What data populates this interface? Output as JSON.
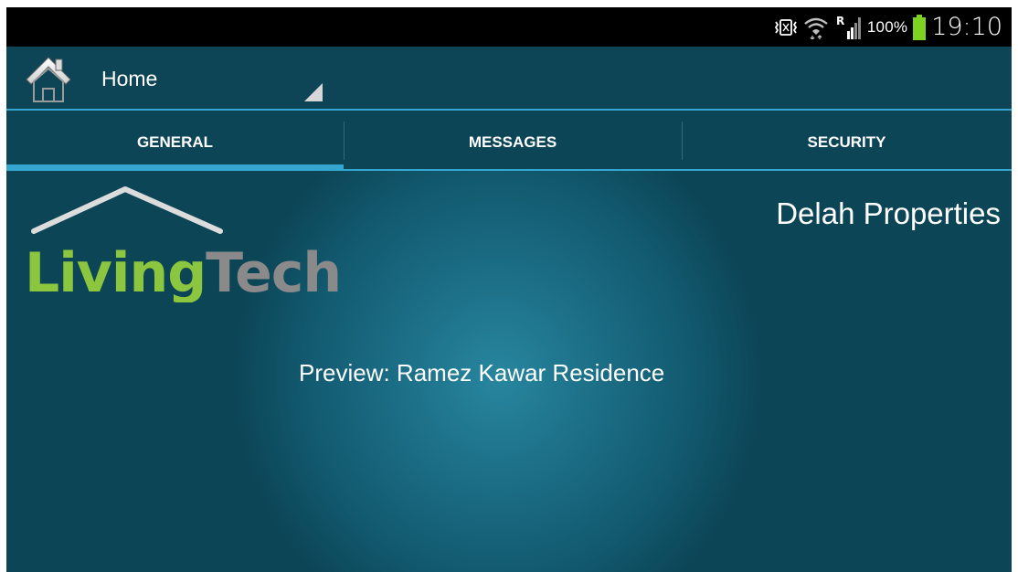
{
  "status_bar": {
    "battery_percent": "100%",
    "time": "19:10",
    "icons": [
      "vibrate-icon",
      "wifi-icon",
      "roaming-signal-icon",
      "battery-icon"
    ],
    "roaming_label": "R"
  },
  "action_bar": {
    "title": "Home",
    "icon": "home-icon"
  },
  "tabs": [
    {
      "label": "GENERAL",
      "active": true
    },
    {
      "label": "MESSAGES",
      "active": false
    },
    {
      "label": "SECURITY",
      "active": false
    }
  ],
  "content": {
    "logo_text_part1": "Living",
    "logo_text_part2": "Tech",
    "company_name": "Delah Properties",
    "preview": "Preview: Ramez Kawar Residence"
  },
  "colors": {
    "background": "#0c4556",
    "accent": "#34a6d0",
    "logo_green": "#8cc63f",
    "logo_gray": "#8a8a8a",
    "battery_green": "#7ed321"
  }
}
